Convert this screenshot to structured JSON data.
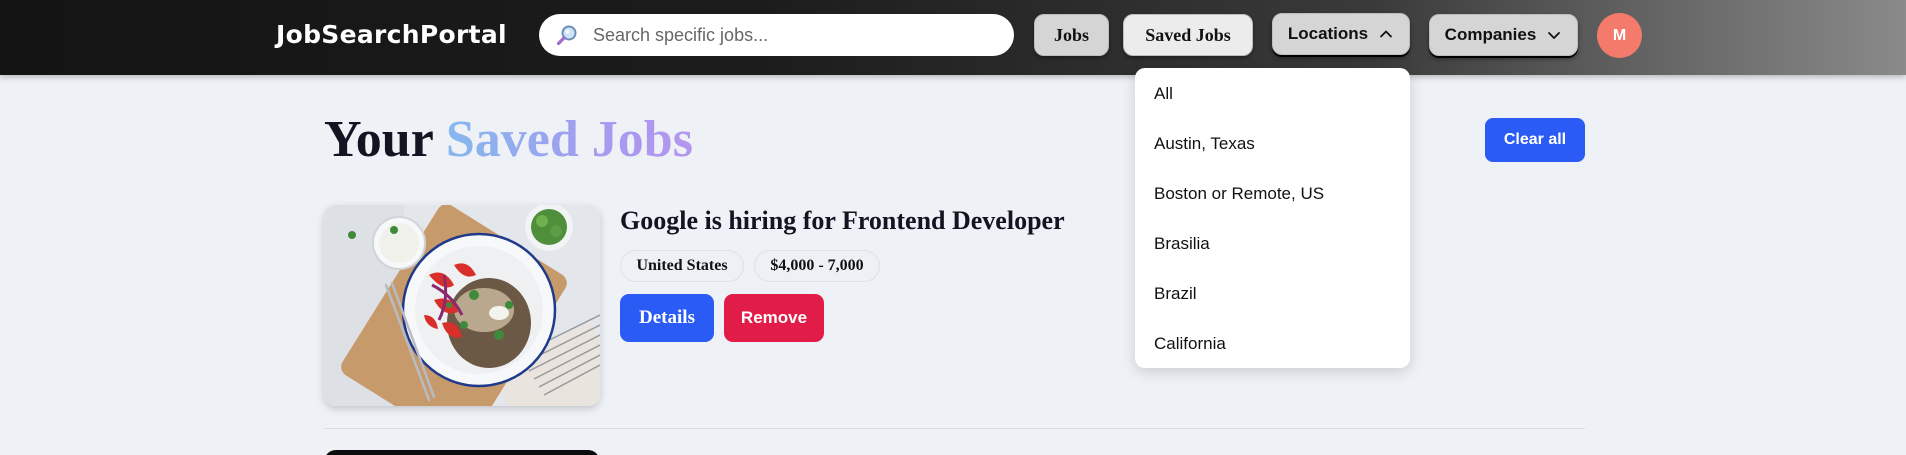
{
  "header": {
    "brand": "JobSearchPortal",
    "search": {
      "placeholder": "Search specific jobs...",
      "value": ""
    },
    "nav": {
      "jobs": "Jobs",
      "saved_jobs": "Saved Jobs",
      "locations": "Locations",
      "companies": "Companies"
    },
    "avatar_initial": "M"
  },
  "locations_dropdown": {
    "open": true,
    "items": [
      "All",
      "Austin, Texas",
      "Boston or Remote, US",
      "Brasilia",
      "Brazil",
      "California"
    ]
  },
  "main": {
    "title_prefix": "Your",
    "title_accent": "Saved Jobs",
    "clear_all": "Clear all",
    "saved_jobs": [
      {
        "title": "Google is hiring for Frontend Developer",
        "location": "United States",
        "salary": "$4,000 - 7,000",
        "details_label": "Details",
        "remove_label": "Remove"
      }
    ]
  },
  "colors": {
    "primary": "#2a5bf5",
    "danger": "#e21c48",
    "avatar": "#f47a6b",
    "page_bg": "#eef1f6"
  },
  "icons": {
    "search": "magnifier-icon",
    "locations": "chevron-up-icon",
    "companies": "chevron-down-icon"
  }
}
